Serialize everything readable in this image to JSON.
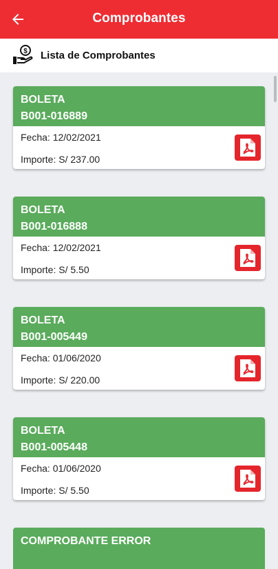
{
  "appbar": {
    "title": "Comprobantes"
  },
  "subheader": {
    "title": "Lista de Comprobantes"
  },
  "cards": [
    {
      "type": "BOLETA",
      "number": "B001-016889",
      "date": "Fecha: 12/02/2021",
      "amount": "Importe: S/ 237.00"
    },
    {
      "type": "BOLETA",
      "number": "B001-016888",
      "date": "Fecha: 12/02/2021",
      "amount": "Importe: S/ 5.50"
    },
    {
      "type": "BOLETA",
      "number": "B001-005449",
      "date": "Fecha: 01/06/2020",
      "amount": "Importe: S/ 220.00"
    },
    {
      "type": "BOLETA",
      "number": "B001-005448",
      "date": "Fecha: 01/06/2020",
      "amount": "Importe: S/ 5.50"
    },
    {
      "type": "COMPROBANTE ERROR"
    }
  ],
  "colors": {
    "primary": "#ee2d33",
    "card_header": "#5aab5c",
    "pdf_button": "#e5252c",
    "background": "#eceef1"
  },
  "icons": {
    "back": "arrow-left-icon",
    "subheader": "hand-money-icon",
    "document": "pdf-file-icon"
  }
}
